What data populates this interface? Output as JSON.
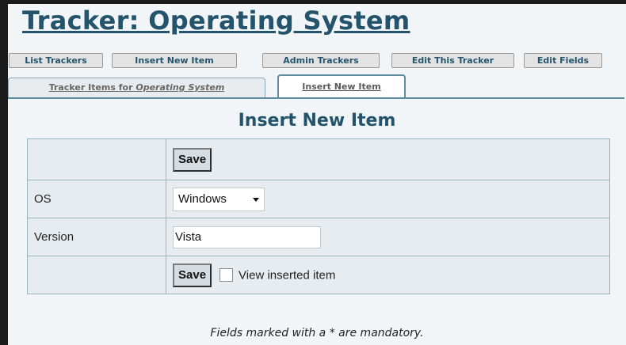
{
  "header": {
    "title": "Tracker: Operating System"
  },
  "toolbar": {
    "list_trackers": "List Trackers",
    "insert_new_item": "Insert New Item",
    "admin_trackers": "Admin Trackers",
    "edit_this_tracker": "Edit This Tracker",
    "edit_fields": "Edit Fields"
  },
  "tabs": {
    "items_prefix": "Tracker Items for ",
    "items_tracker": "Operating System",
    "insert": "Insert New Item"
  },
  "form": {
    "heading": "Insert New Item",
    "save_label": "Save",
    "os_label": "OS",
    "os_value": "Windows",
    "version_label": "Version",
    "version_value": "Vista",
    "view_inserted_label": "View inserted item",
    "view_inserted_checked": false,
    "footer_note": "Fields marked with a * are mandatory."
  }
}
